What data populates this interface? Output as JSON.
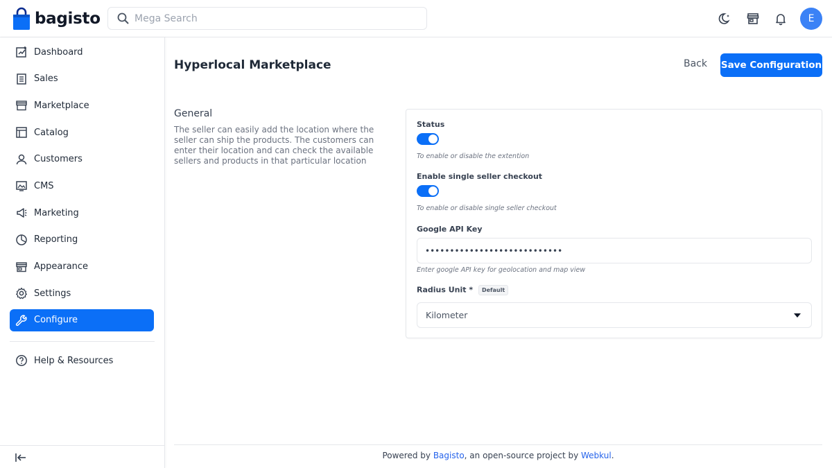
{
  "brand": {
    "name": "bagisto"
  },
  "search": {
    "placeholder": "Mega Search"
  },
  "header": {
    "icons": [
      "dark-mode-icon",
      "storefront-icon",
      "notification-bell-icon"
    ],
    "avatar_initial": "E"
  },
  "sidebar": {
    "items": [
      {
        "label": "Dashboard",
        "icon": "dashboard-icon"
      },
      {
        "label": "Sales",
        "icon": "sales-icon"
      },
      {
        "label": "Marketplace",
        "icon": "marketplace-icon"
      },
      {
        "label": "Catalog",
        "icon": "catalog-icon"
      },
      {
        "label": "Customers",
        "icon": "customers-icon"
      },
      {
        "label": "CMS",
        "icon": "cms-icon"
      },
      {
        "label": "Marketing",
        "icon": "marketing-icon"
      },
      {
        "label": "Reporting",
        "icon": "reporting-icon"
      },
      {
        "label": "Appearance",
        "icon": "appearance-icon"
      },
      {
        "label": "Settings",
        "icon": "settings-icon"
      },
      {
        "label": "Configure",
        "icon": "configure-icon",
        "active": true
      }
    ],
    "help": {
      "label": "Help & Resources",
      "icon": "help-icon"
    }
  },
  "page": {
    "title": "Hyperlocal Marketplace",
    "back_label": "Back",
    "save_label": "Save Configuration"
  },
  "section": {
    "title": "General",
    "description": "The seller can easily add the location where the seller can ship the products. The customers can enter their location and can check the available sellers and products in that particular location"
  },
  "fields": {
    "status": {
      "label": "Status",
      "enabled": true,
      "hint": "To enable or disable the extention"
    },
    "single_checkout": {
      "label": "Enable single seller checkout",
      "enabled": true,
      "hint": "To enable or disable single seller checkout"
    },
    "api_key": {
      "label": "Google API Key",
      "value": "••••••••••••••••••••••••••••",
      "hint": "Enter google API key for geolocation and map view"
    },
    "radius_unit": {
      "label": "Radius Unit *",
      "badge": "Default",
      "value": "Kilometer"
    }
  },
  "footer": {
    "prefix": "Powered by ",
    "link1": "Bagisto",
    "middle": ", an open-source project by ",
    "link2": "Webkul",
    "suffix": "."
  },
  "colors": {
    "primary": "#0b6ff7",
    "avatar": "#3b82f6",
    "link": "#2563eb"
  }
}
